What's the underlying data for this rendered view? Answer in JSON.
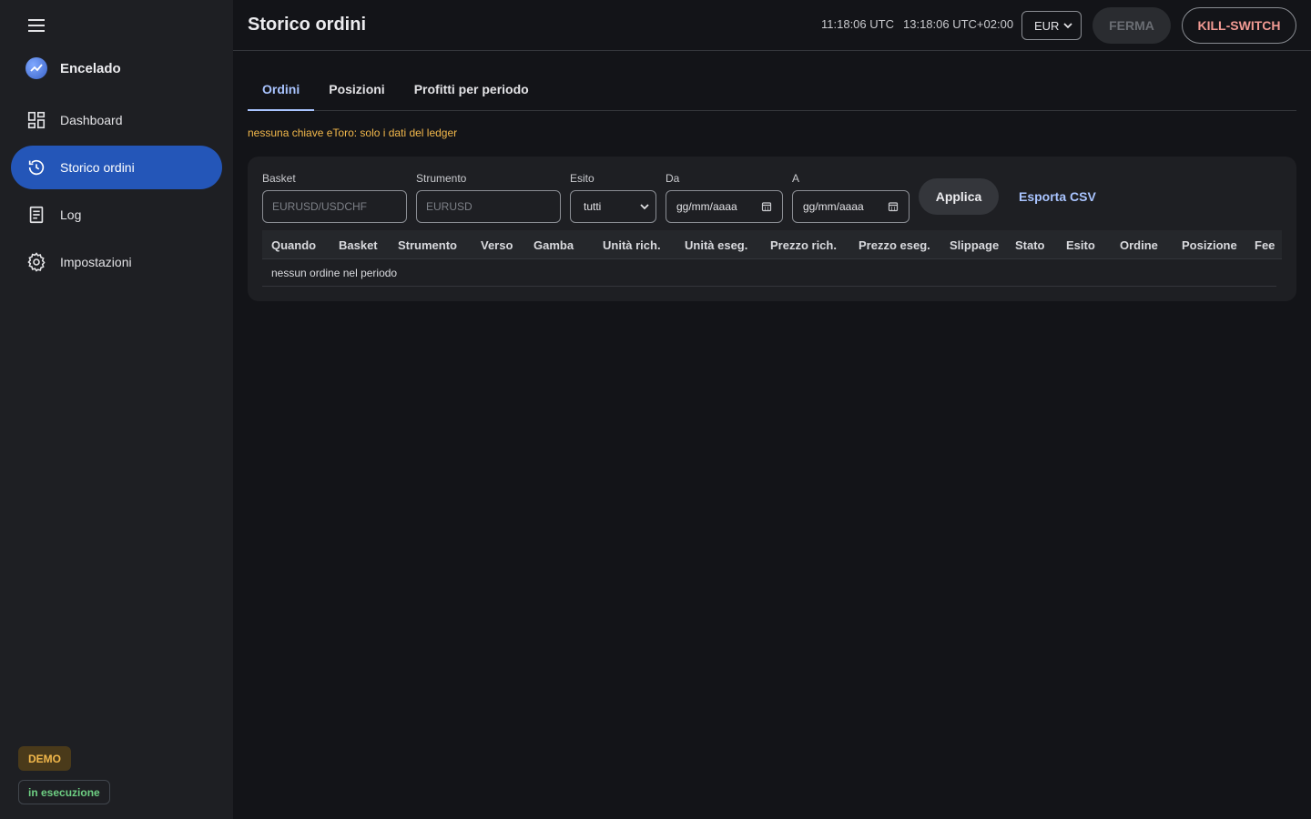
{
  "app": {
    "name": "Encelado",
    "menu_icon": "menu-icon",
    "logo_icon": "trend-logo-icon"
  },
  "sidebar": {
    "items": [
      {
        "label": "Dashboard",
        "icon": "dashboard-icon",
        "active": false
      },
      {
        "label": "Storico ordini",
        "icon": "history-icon",
        "active": true
      },
      {
        "label": "Log",
        "icon": "document-icon",
        "active": false
      },
      {
        "label": "Impostazioni",
        "icon": "gear-icon",
        "active": false
      }
    ],
    "badges": {
      "mode": "DEMO",
      "status": "in esecuzione"
    }
  },
  "header": {
    "title": "Storico ordini",
    "time_utc": "11:18:06 UTC",
    "time_local": "13:18:06 UTC+02:00",
    "currency": "EUR",
    "stop_label": "FERMA",
    "kill_label": "KILL-SWITCH"
  },
  "tabs": [
    {
      "label": "Ordini",
      "active": true
    },
    {
      "label": "Posizioni",
      "active": false
    },
    {
      "label": "Profitti per periodo",
      "active": false
    }
  ],
  "notice": "nessuna chiave eToro: solo i dati del ledger",
  "filters": {
    "basket": {
      "label": "Basket",
      "placeholder": "EURUSD/USDCHF"
    },
    "strumento": {
      "label": "Strumento",
      "placeholder": "EURUSD"
    },
    "esito": {
      "label": "Esito",
      "value": "tutti"
    },
    "da": {
      "label": "Da",
      "placeholder": "gg/mm/aaaa"
    },
    "a": {
      "label": "A",
      "placeholder": "gg/mm/aaaa"
    },
    "apply_label": "Applica",
    "export_label": "Esporta CSV"
  },
  "table": {
    "columns": [
      "Quando",
      "Basket",
      "Strumento",
      "Verso",
      "Gamba",
      "Unità rich.",
      "Unità eseg.",
      "Prezzo rich.",
      "Prezzo eseg.",
      "Slippage",
      "Stato",
      "Esito",
      "Ordine",
      "Posizione",
      "Fee"
    ],
    "empty_message": "nessun ordine nel periodo"
  },
  "colors": {
    "accent": "#2456b8",
    "tab_active": "#a9c4ff",
    "warning": "#f2b84b",
    "danger": "#f19a93",
    "success": "#6ecf83"
  }
}
